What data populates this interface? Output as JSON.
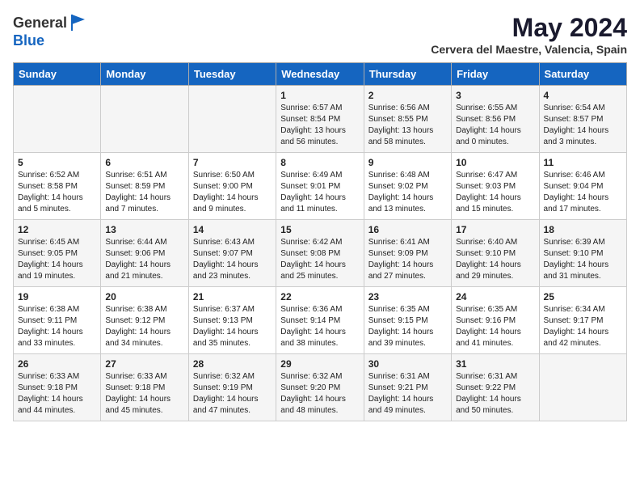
{
  "header": {
    "logo_general": "General",
    "logo_blue": "Blue",
    "month_year": "May 2024",
    "location": "Cervera del Maestre, Valencia, Spain"
  },
  "weekdays": [
    "Sunday",
    "Monday",
    "Tuesday",
    "Wednesday",
    "Thursday",
    "Friday",
    "Saturday"
  ],
  "weeks": [
    [
      {
        "day": "",
        "info": ""
      },
      {
        "day": "",
        "info": ""
      },
      {
        "day": "",
        "info": ""
      },
      {
        "day": "1",
        "info": "Sunrise: 6:57 AM\nSunset: 8:54 PM\nDaylight: 13 hours\nand 56 minutes."
      },
      {
        "day": "2",
        "info": "Sunrise: 6:56 AM\nSunset: 8:55 PM\nDaylight: 13 hours\nand 58 minutes."
      },
      {
        "day": "3",
        "info": "Sunrise: 6:55 AM\nSunset: 8:56 PM\nDaylight: 14 hours\nand 0 minutes."
      },
      {
        "day": "4",
        "info": "Sunrise: 6:54 AM\nSunset: 8:57 PM\nDaylight: 14 hours\nand 3 minutes."
      }
    ],
    [
      {
        "day": "5",
        "info": "Sunrise: 6:52 AM\nSunset: 8:58 PM\nDaylight: 14 hours\nand 5 minutes."
      },
      {
        "day": "6",
        "info": "Sunrise: 6:51 AM\nSunset: 8:59 PM\nDaylight: 14 hours\nand 7 minutes."
      },
      {
        "day": "7",
        "info": "Sunrise: 6:50 AM\nSunset: 9:00 PM\nDaylight: 14 hours\nand 9 minutes."
      },
      {
        "day": "8",
        "info": "Sunrise: 6:49 AM\nSunset: 9:01 PM\nDaylight: 14 hours\nand 11 minutes."
      },
      {
        "day": "9",
        "info": "Sunrise: 6:48 AM\nSunset: 9:02 PM\nDaylight: 14 hours\nand 13 minutes."
      },
      {
        "day": "10",
        "info": "Sunrise: 6:47 AM\nSunset: 9:03 PM\nDaylight: 14 hours\nand 15 minutes."
      },
      {
        "day": "11",
        "info": "Sunrise: 6:46 AM\nSunset: 9:04 PM\nDaylight: 14 hours\nand 17 minutes."
      }
    ],
    [
      {
        "day": "12",
        "info": "Sunrise: 6:45 AM\nSunset: 9:05 PM\nDaylight: 14 hours\nand 19 minutes."
      },
      {
        "day": "13",
        "info": "Sunrise: 6:44 AM\nSunset: 9:06 PM\nDaylight: 14 hours\nand 21 minutes."
      },
      {
        "day": "14",
        "info": "Sunrise: 6:43 AM\nSunset: 9:07 PM\nDaylight: 14 hours\nand 23 minutes."
      },
      {
        "day": "15",
        "info": "Sunrise: 6:42 AM\nSunset: 9:08 PM\nDaylight: 14 hours\nand 25 minutes."
      },
      {
        "day": "16",
        "info": "Sunrise: 6:41 AM\nSunset: 9:09 PM\nDaylight: 14 hours\nand 27 minutes."
      },
      {
        "day": "17",
        "info": "Sunrise: 6:40 AM\nSunset: 9:10 PM\nDaylight: 14 hours\nand 29 minutes."
      },
      {
        "day": "18",
        "info": "Sunrise: 6:39 AM\nSunset: 9:10 PM\nDaylight: 14 hours\nand 31 minutes."
      }
    ],
    [
      {
        "day": "19",
        "info": "Sunrise: 6:38 AM\nSunset: 9:11 PM\nDaylight: 14 hours\nand 33 minutes."
      },
      {
        "day": "20",
        "info": "Sunrise: 6:38 AM\nSunset: 9:12 PM\nDaylight: 14 hours\nand 34 minutes."
      },
      {
        "day": "21",
        "info": "Sunrise: 6:37 AM\nSunset: 9:13 PM\nDaylight: 14 hours\nand 35 minutes."
      },
      {
        "day": "22",
        "info": "Sunrise: 6:36 AM\nSunset: 9:14 PM\nDaylight: 14 hours\nand 38 minutes."
      },
      {
        "day": "23",
        "info": "Sunrise: 6:35 AM\nSunset: 9:15 PM\nDaylight: 14 hours\nand 39 minutes."
      },
      {
        "day": "24",
        "info": "Sunrise: 6:35 AM\nSunset: 9:16 PM\nDaylight: 14 hours\nand 41 minutes."
      },
      {
        "day": "25",
        "info": "Sunrise: 6:34 AM\nSunset: 9:17 PM\nDaylight: 14 hours\nand 42 minutes."
      }
    ],
    [
      {
        "day": "26",
        "info": "Sunrise: 6:33 AM\nSunset: 9:18 PM\nDaylight: 14 hours\nand 44 minutes."
      },
      {
        "day": "27",
        "info": "Sunrise: 6:33 AM\nSunset: 9:18 PM\nDaylight: 14 hours\nand 45 minutes."
      },
      {
        "day": "28",
        "info": "Sunrise: 6:32 AM\nSunset: 9:19 PM\nDaylight: 14 hours\nand 47 minutes."
      },
      {
        "day": "29",
        "info": "Sunrise: 6:32 AM\nSunset: 9:20 PM\nDaylight: 14 hours\nand 48 minutes."
      },
      {
        "day": "30",
        "info": "Sunrise: 6:31 AM\nSunset: 9:21 PM\nDaylight: 14 hours\nand 49 minutes."
      },
      {
        "day": "31",
        "info": "Sunrise: 6:31 AM\nSunset: 9:22 PM\nDaylight: 14 hours\nand 50 minutes."
      },
      {
        "day": "",
        "info": ""
      }
    ]
  ]
}
